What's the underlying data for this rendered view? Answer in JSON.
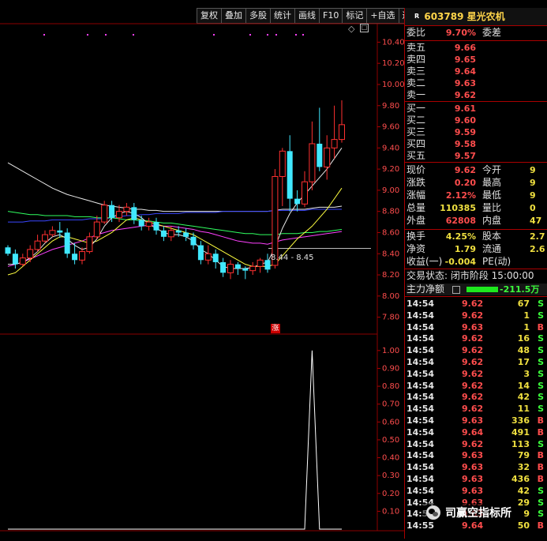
{
  "toolbar": {
    "buttons": [
      "复权",
      "叠加",
      "多股",
      "统计",
      "画线",
      "F10",
      "标记",
      "+自选",
      "返回"
    ]
  },
  "stock": {
    "badge": "R",
    "code_name": "603789 星光农机"
  },
  "main_chart": {
    "y_ticks": [
      "10.40",
      "10.20",
      "10.00",
      "9.80",
      "9.60",
      "9.40",
      "9.20",
      "9.00",
      "8.80",
      "8.60",
      "8.40",
      "8.20",
      "8.00",
      "7.80"
    ],
    "range_label": "8.44 - 8.45",
    "zhang_marker": "涨"
  },
  "sub_chart": {
    "y_ticks": [
      "1.00",
      "0.90",
      "0.80",
      "0.70",
      "0.60",
      "0.50",
      "0.40",
      "0.30",
      "0.20",
      "0.10"
    ]
  },
  "chart_data": [
    {
      "type": "line",
      "title": "",
      "y_ticks": [
        10.4,
        10.2,
        10.0,
        9.8,
        9.6,
        9.4,
        9.2,
        9.0,
        8.8,
        8.6,
        8.4,
        8.2,
        8.0,
        7.8
      ],
      "ylim": [
        7.7,
        10.5
      ],
      "range_label": "8.44 - 8.45",
      "candles": [
        [
          8.46,
          8.4,
          8.48,
          8.38
        ],
        [
          8.4,
          8.3,
          8.44,
          8.26
        ],
        [
          8.3,
          8.36,
          8.4,
          8.28
        ],
        [
          8.36,
          8.44,
          8.48,
          8.32
        ],
        [
          8.44,
          8.52,
          8.58,
          8.42
        ],
        [
          8.52,
          8.58,
          8.62,
          8.5
        ],
        [
          8.58,
          8.62,
          8.66,
          8.56
        ],
        [
          8.62,
          8.6,
          8.7,
          8.55
        ],
        [
          8.6,
          8.4,
          8.64,
          8.36
        ],
        [
          8.4,
          8.34,
          8.5,
          8.3
        ],
        [
          8.34,
          8.42,
          8.46,
          8.3
        ],
        [
          8.42,
          8.56,
          8.6,
          8.4
        ],
        [
          8.56,
          8.7,
          8.76,
          8.54
        ],
        [
          8.7,
          8.86,
          8.9,
          8.68
        ],
        [
          8.86,
          8.74,
          8.9,
          8.7
        ],
        [
          8.74,
          8.8,
          8.86,
          8.7
        ],
        [
          8.8,
          8.84,
          8.88,
          8.76
        ],
        [
          8.84,
          8.72,
          8.88,
          8.68
        ],
        [
          8.72,
          8.66,
          8.76,
          8.62
        ],
        [
          8.66,
          8.7,
          8.74,
          8.62
        ],
        [
          8.7,
          8.62,
          8.74,
          8.58
        ],
        [
          8.62,
          8.56,
          8.66,
          8.52
        ],
        [
          8.56,
          8.62,
          8.66,
          8.52
        ],
        [
          8.62,
          8.6,
          8.66,
          8.56
        ],
        [
          8.6,
          8.56,
          8.64,
          8.52
        ],
        [
          8.56,
          8.48,
          8.6,
          8.44
        ],
        [
          8.48,
          8.34,
          8.52,
          8.3
        ],
        [
          8.34,
          8.4,
          8.48,
          8.3
        ],
        [
          8.4,
          8.32,
          8.44,
          8.26
        ],
        [
          8.32,
          8.22,
          8.36,
          8.18
        ],
        [
          8.22,
          8.3,
          8.34,
          8.16
        ],
        [
          8.3,
          8.26,
          8.32,
          8.2
        ],
        [
          8.26,
          8.24,
          8.28,
          8.16
        ],
        [
          8.24,
          8.28,
          8.32,
          8.2
        ],
        [
          8.28,
          8.34,
          8.36,
          8.22
        ],
        [
          8.34,
          8.25,
          8.4,
          8.22
        ],
        [
          8.29,
          9.13,
          9.2,
          8.26
        ],
        [
          9.13,
          9.37,
          9.4,
          8.85
        ],
        [
          9.37,
          8.92,
          9.52,
          8.8
        ],
        [
          8.92,
          8.87,
          9.0,
          8.8
        ],
        [
          8.87,
          9.08,
          9.18,
          8.84
        ],
        [
          9.08,
          9.44,
          9.65,
          9.0
        ],
        [
          9.44,
          9.22,
          9.78,
          9.18
        ],
        [
          9.22,
          9.4,
          9.52,
          9.1
        ],
        [
          9.4,
          9.48,
          9.8,
          9.3
        ],
        [
          9.48,
          9.62,
          9.85,
          9.45
        ]
      ],
      "series": [
        {
          "color": "#e8e8e8",
          "values": [
            9.26,
            9.22,
            9.18,
            9.14,
            9.1,
            9.06,
            9.02,
            8.99,
            8.96,
            8.94,
            8.92,
            8.9,
            8.88,
            8.86,
            8.85,
            8.84,
            8.83,
            8.82,
            8.82,
            8.81,
            8.81,
            8.8,
            8.8,
            8.8,
            8.8,
            8.8,
            8.8,
            8.8,
            8.8,
            8.8,
            8.8,
            8.8,
            8.8,
            8.8,
            8.8,
            8.8,
            8.81,
            8.82,
            8.82,
            8.82,
            8.82,
            8.83,
            8.84,
            8.84,
            8.84,
            8.85
          ]
        },
        {
          "color": "#3a46ff",
          "values": [
            8.7,
            8.7,
            8.7,
            8.71,
            8.71,
            8.71,
            8.72,
            8.72,
            8.72,
            8.72,
            8.72,
            8.73,
            8.73,
            8.73,
            8.74,
            8.75,
            8.76,
            8.76,
            8.77,
            8.77,
            8.78,
            8.78,
            8.78,
            8.78,
            8.79,
            8.79,
            8.79,
            8.79,
            8.79,
            8.8,
            8.8,
            8.8,
            8.8,
            8.8,
            8.8,
            8.8,
            8.81,
            8.81,
            8.81,
            8.81,
            8.81,
            8.82,
            8.82,
            8.82,
            8.82,
            8.82
          ]
        },
        {
          "color": "#30ff60",
          "values": [
            8.8,
            8.79,
            8.78,
            8.77,
            8.77,
            8.76,
            8.76,
            8.76,
            8.76,
            8.75,
            8.75,
            8.75,
            8.74,
            8.74,
            8.74,
            8.73,
            8.72,
            8.72,
            8.71,
            8.71,
            8.7,
            8.69,
            8.69,
            8.68,
            8.67,
            8.66,
            8.65,
            8.64,
            8.63,
            8.62,
            8.61,
            8.6,
            8.59,
            8.59,
            8.58,
            8.58,
            8.58,
            8.59,
            8.59,
            8.59,
            8.6,
            8.6,
            8.61,
            8.61,
            8.62,
            8.63
          ]
        },
        {
          "color": "#ff40ff",
          "values": [
            8.28,
            8.3,
            8.32,
            8.35,
            8.38,
            8.41,
            8.44,
            8.46,
            8.48,
            8.5,
            8.52,
            8.55,
            8.58,
            8.6,
            8.62,
            8.63,
            8.64,
            8.65,
            8.66,
            8.67,
            8.67,
            8.66,
            8.66,
            8.65,
            8.64,
            8.63,
            8.61,
            8.6,
            8.58,
            8.56,
            8.54,
            8.52,
            8.51,
            8.5,
            8.5,
            8.49,
            8.51,
            8.53,
            8.54,
            8.55,
            8.56,
            8.57,
            8.58,
            8.59,
            8.6,
            8.61
          ]
        },
        {
          "color": "#ffff40",
          "values": [
            8.2,
            8.22,
            8.28,
            8.34,
            8.4,
            8.46,
            8.52,
            8.56,
            8.56,
            8.54,
            8.52,
            8.5,
            8.52,
            8.56,
            8.6,
            8.66,
            8.72,
            8.74,
            8.72,
            8.7,
            8.68,
            8.66,
            8.64,
            8.62,
            8.6,
            8.58,
            8.54,
            8.5,
            8.46,
            8.42,
            8.38,
            8.34,
            8.3,
            8.28,
            8.28,
            8.28,
            8.3,
            8.38,
            8.46,
            8.54,
            8.6,
            8.66,
            8.74,
            8.82,
            8.92,
            9.02
          ]
        },
        {
          "color": "#e8e8e8",
          "values": [
            8.3,
            8.3,
            8.32,
            8.36,
            8.42,
            8.5,
            8.56,
            8.58,
            8.54,
            8.48,
            8.44,
            8.46,
            8.54,
            8.66,
            8.74,
            8.78,
            8.8,
            8.78,
            8.74,
            8.68,
            8.64,
            8.6,
            8.58,
            8.58,
            8.56,
            8.52,
            8.44,
            8.4,
            8.34,
            8.28,
            8.26,
            8.26,
            8.26,
            8.27,
            8.3,
            8.32,
            8.46,
            8.64,
            8.78,
            8.88,
            8.96,
            9.04,
            9.12,
            9.2,
            9.3,
            9.4
          ]
        }
      ]
    },
    {
      "type": "line",
      "title": "",
      "y_ticks": [
        1.0,
        0.9,
        0.8,
        0.7,
        0.6,
        0.5,
        0.4,
        0.3,
        0.2,
        0.1
      ],
      "ylim": [
        0.0,
        1.07
      ],
      "series": [
        {
          "color": "#ffffff",
          "values": [
            0,
            0,
            0,
            0,
            0,
            0,
            0,
            0,
            0,
            0,
            0,
            0,
            0,
            0,
            0,
            0,
            0,
            0,
            0,
            0,
            0,
            0,
            0,
            0,
            0,
            0,
            0,
            0,
            0,
            0,
            0,
            0,
            0,
            0,
            0,
            0,
            0,
            0,
            0,
            0,
            0,
            1.0,
            0,
            0,
            0,
            0
          ]
        }
      ]
    }
  ],
  "panel": {
    "weibi": {
      "label": "委比",
      "value": "9.70%",
      "label2": "委差"
    },
    "asks": [
      {
        "label": "卖五",
        "price": "9.66"
      },
      {
        "label": "卖四",
        "price": "9.65"
      },
      {
        "label": "卖三",
        "price": "9.64"
      },
      {
        "label": "卖二",
        "price": "9.63"
      },
      {
        "label": "卖一",
        "price": "9.62"
      }
    ],
    "bids": [
      {
        "label": "买一",
        "price": "9.61"
      },
      {
        "label": "买二",
        "price": "9.60"
      },
      {
        "label": "买三",
        "price": "9.59"
      },
      {
        "label": "买四",
        "price": "9.58"
      },
      {
        "label": "买五",
        "price": "9.57"
      }
    ],
    "stats": [
      {
        "l1": "现价",
        "v1": "9.62",
        "l2": "今开",
        "v2": "9"
      },
      {
        "l1": "涨跌",
        "v1": "0.20",
        "l2": "最高",
        "v2": "9"
      },
      {
        "l1": "涨幅",
        "v1": "2.12%",
        "l2": "最低",
        "v2": "9"
      },
      {
        "l1": "总量",
        "v1": "110385",
        "l2": "量比",
        "v2": "0"
      },
      {
        "l1": "外盘",
        "v1": "62808",
        "l2": "内盘",
        "v2": "47"
      }
    ],
    "stats2": [
      {
        "l1": "换手",
        "v1": "4.25%",
        "l2": "股本",
        "v2": "2.7"
      },
      {
        "l1": "净资",
        "v1": "1.79",
        "l2": "流通",
        "v2": "2.6"
      },
      {
        "l1": "收益(一)",
        "v1": "-0.004",
        "l2": "PE(动)",
        "v2": ""
      }
    ],
    "trade_status": "交易状态: 闭市阶段 15:00:00",
    "main_force": {
      "label": "主力净额",
      "value": "-211.5万"
    },
    "ticks": [
      {
        "t": "14:54",
        "p": "9.62",
        "v": "67",
        "s": "S"
      },
      {
        "t": "14:54",
        "p": "9.62",
        "v": "1",
        "s": "S"
      },
      {
        "t": "14:54",
        "p": "9.63",
        "v": "1",
        "s": "B"
      },
      {
        "t": "14:54",
        "p": "9.62",
        "v": "16",
        "s": "S"
      },
      {
        "t": "14:54",
        "p": "9.62",
        "v": "48",
        "s": "S"
      },
      {
        "t": "14:54",
        "p": "9.62",
        "v": "17",
        "s": "S"
      },
      {
        "t": "14:54",
        "p": "9.62",
        "v": "3",
        "s": "S"
      },
      {
        "t": "14:54",
        "p": "9.62",
        "v": "14",
        "s": "S"
      },
      {
        "t": "14:54",
        "p": "9.62",
        "v": "42",
        "s": "S"
      },
      {
        "t": "14:54",
        "p": "9.62",
        "v": "11",
        "s": "S"
      },
      {
        "t": "14:54",
        "p": "9.63",
        "v": "336",
        "s": "B"
      },
      {
        "t": "14:54",
        "p": "9.64",
        "v": "491",
        "s": "B"
      },
      {
        "t": "14:54",
        "p": "9.62",
        "v": "113",
        "s": "S"
      },
      {
        "t": "14:54",
        "p": "9.63",
        "v": "79",
        "s": "B"
      },
      {
        "t": "14:54",
        "p": "9.63",
        "v": "32",
        "s": "B"
      },
      {
        "t": "14:54",
        "p": "9.63",
        "v": "436",
        "s": "B"
      },
      {
        "t": "14:54",
        "p": "9.63",
        "v": "42",
        "s": "S"
      },
      {
        "t": "14:54",
        "p": "9.63",
        "v": "29",
        "s": "S"
      },
      {
        "t": "14:55",
        "p": "9.63",
        "v": "9",
        "s": "S"
      },
      {
        "t": "14:55",
        "p": "9.64",
        "v": "50",
        "s": "B"
      }
    ]
  },
  "watermark": "司赢空指标所"
}
